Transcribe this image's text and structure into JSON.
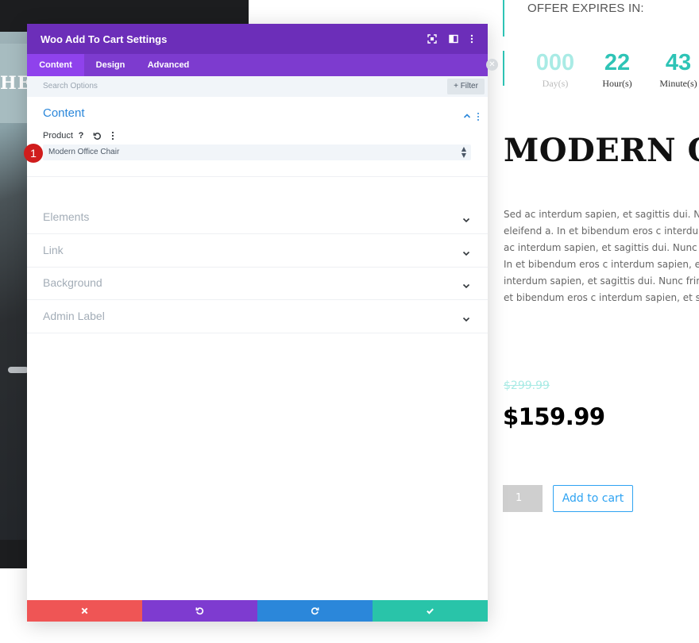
{
  "background_page": {
    "hero_text": "HE I",
    "offer": {
      "label": "OFFER EXPIRES IN:"
    },
    "countdown": [
      {
        "value": "000",
        "label": "Day(s)"
      },
      {
        "value": "22",
        "label": "Hour(s)"
      },
      {
        "value": "43",
        "label": "Minute(s)"
      }
    ],
    "product": {
      "title": "MODERN OF",
      "description_lines": [
        "Sed ac interdum sapien, et sagittis dui. Nu",
        "eleifend a. In et bibendum eros c interdum s",
        "ac interdum sapien, et sagittis dui. Nunc fring",
        "In et bibendum eros c interdum sapien, e",
        "interdum sapien, et sagittis dui. Nunc fringilla",
        "et bibendum eros c interdum sapien, et sagit"
      ],
      "old_price": "$299.99",
      "new_price": "$159.99",
      "quantity": "1",
      "add_to_cart_label": "Add to cart"
    },
    "colors": {
      "accent": "#2ec4b6",
      "button": "#2ea3f2"
    }
  },
  "modal": {
    "title": "Woo Add To Cart Settings",
    "header_icons": [
      "fullscreen-icon",
      "split-view-icon",
      "more-options-icon"
    ],
    "tabs": [
      {
        "label": "Content",
        "active": true
      },
      {
        "label": "Design",
        "active": false
      },
      {
        "label": "Advanced",
        "active": false
      }
    ],
    "search": {
      "placeholder": "Search Options"
    },
    "filter_label": "+ Filter",
    "sections": {
      "content": {
        "title": "Content",
        "product_label": "Product",
        "help_glyph": "?",
        "product_value": "Modern Office Chair",
        "step_badge": "1"
      },
      "collapsed": [
        {
          "title": "Elements"
        },
        {
          "title": "Link"
        },
        {
          "title": "Background"
        },
        {
          "title": "Admin Label"
        }
      ]
    },
    "footer": [
      "cancel",
      "undo",
      "redo",
      "save"
    ],
    "colors": {
      "header": "#6c2eb9",
      "tabs": "#7d3bcf",
      "active_tab": "#8f42ec",
      "section_open": "#2b87da",
      "cancel": "#ef5555",
      "undo": "#7e3bd0",
      "redo": "#2b87da",
      "save": "#29c4a9"
    }
  }
}
